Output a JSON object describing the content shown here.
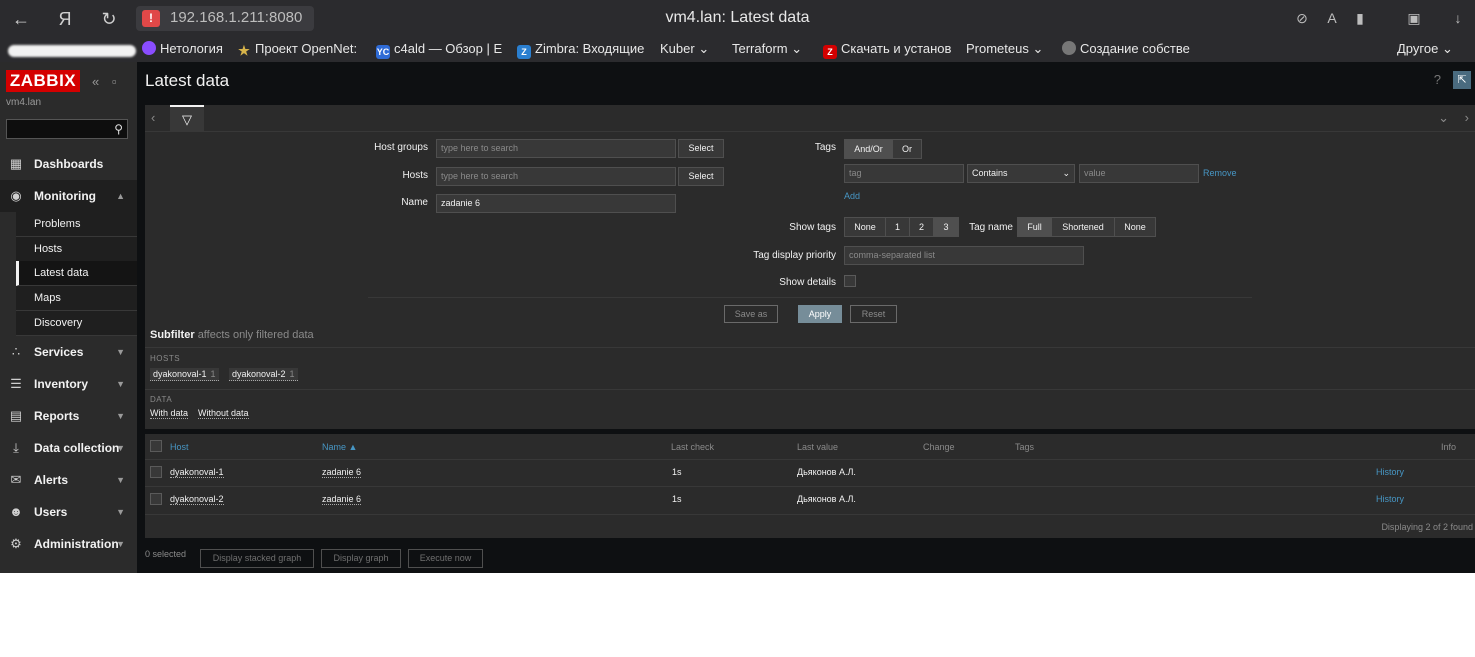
{
  "browser": {
    "address": "192.168.1.211:8080",
    "tab_title": "vm4.lan: Latest data",
    "bookmarks": [
      {
        "label": "Нетология",
        "icon": "netology-icon",
        "color": "#8a4dff"
      },
      {
        "label": "Проект OpenNet:",
        "icon": "star-icon",
        "color": "#d8b44a"
      },
      {
        "label": "c4ald — Обзор | E",
        "icon": "yc-icon",
        "color": "#2f6bd6"
      },
      {
        "label": "Zimbra: Входящие",
        "icon": "zimbra-icon",
        "color": "#2a7fd0"
      },
      {
        "label": "Kuber",
        "icon": "folder-icon"
      },
      {
        "label": "Terraform",
        "icon": "folder-icon"
      },
      {
        "label": "Скачать и установ",
        "icon": "z-red-icon",
        "color": "#d40000"
      },
      {
        "label": "Prometeus",
        "icon": "folder-icon"
      },
      {
        "label": "Создание собстве",
        "icon": "globe-icon"
      },
      {
        "label": "Другое",
        "icon": "folder-icon"
      }
    ]
  },
  "sidebar": {
    "logo": "ZABBIX",
    "server_name": "vm4.lan",
    "menu": [
      {
        "label": "Dashboards",
        "icon": "dashboard-icon"
      },
      {
        "label": "Monitoring",
        "icon": "eye-icon",
        "open": true
      },
      {
        "label": "Services",
        "icon": "services-icon"
      },
      {
        "label": "Inventory",
        "icon": "list-icon"
      },
      {
        "label": "Reports",
        "icon": "report-icon"
      },
      {
        "label": "Data collection",
        "icon": "download-icon"
      },
      {
        "label": "Alerts",
        "icon": "envelope-icon"
      },
      {
        "label": "Users",
        "icon": "users-icon"
      },
      {
        "label": "Administration",
        "icon": "gear-icon"
      }
    ],
    "submenu": [
      "Problems",
      "Hosts",
      "Latest data",
      "Maps",
      "Discovery"
    ],
    "active_submenu": "Latest data"
  },
  "header": {
    "title": "Latest data",
    "help": "?"
  },
  "filter": {
    "host_groups_label": "Host groups",
    "hosts_label": "Hosts",
    "name_label": "Name",
    "search_placeholder": "type here to search",
    "select_label": "Select",
    "name_value": "zadanie 6",
    "tags_label": "Tags",
    "tags_mode": [
      "And/Or",
      "Or"
    ],
    "tag_placeholder": "tag",
    "operator": "Contains",
    "value_placeholder": "value",
    "remove_label": "Remove",
    "add_label": "Add",
    "show_tags_label": "Show tags",
    "show_tags_options": [
      "None",
      "1",
      "2",
      "3"
    ],
    "tag_name_label": "Tag name",
    "tag_name_options": [
      "Full",
      "Shortened",
      "None"
    ],
    "tag_priority_label": "Tag display priority",
    "tag_priority_placeholder": "comma-separated list",
    "show_details_label": "Show details",
    "save_as": "Save as",
    "apply": "Apply",
    "reset": "Reset"
  },
  "subfilter": {
    "title": "Subfilter",
    "note": "affects only filtered data",
    "hosts_header": "HOSTS",
    "hosts": [
      {
        "name": "dyakonoval-1",
        "count": "1"
      },
      {
        "name": "dyakonoval-2",
        "count": "1"
      }
    ],
    "data_header": "DATA",
    "data": [
      "With data",
      "Without data"
    ]
  },
  "table": {
    "columns": [
      "Host",
      "Name ▲",
      "Last check",
      "Last value",
      "Change",
      "Tags",
      "Info"
    ],
    "rows": [
      {
        "host": "dyakonoval-1",
        "name": "zadanie 6",
        "last_check": "1s",
        "last_value": "Дьяконов А.Л.",
        "history": "History"
      },
      {
        "host": "dyakonoval-2",
        "name": "zadanie 6",
        "last_check": "1s",
        "last_value": "Дьяконов А.Л.",
        "history": "History"
      }
    ],
    "footer": "Displaying 2 of 2 found"
  },
  "actions": {
    "selected": "0 selected",
    "buttons": [
      "Display stacked graph",
      "Display graph",
      "Execute now"
    ]
  }
}
